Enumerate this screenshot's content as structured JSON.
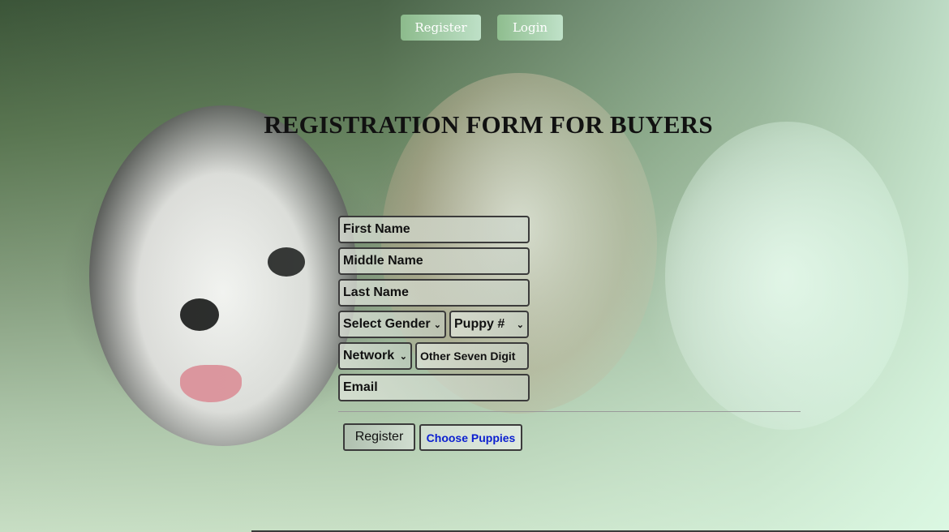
{
  "nav": {
    "register_label": "Register",
    "login_label": "Login"
  },
  "page": {
    "title": "REGISTRATION FORM FOR BUYERS"
  },
  "form": {
    "first_name_placeholder": "First Name",
    "middle_name_placeholder": "Middle Name",
    "last_name_placeholder": "Last Name",
    "gender_select_value": "Select Gender",
    "puppy_select_value": "Puppy #",
    "network_select_value": "Network",
    "seven_digit_placeholder": "Other Seven Digit",
    "email_placeholder": "Email",
    "register_button_label": "Register",
    "choose_puppies_link": "Choose Puppies"
  },
  "colors": {
    "link_blue": "#0b1fd0",
    "nav_button_green": "#a8d8b0"
  }
}
